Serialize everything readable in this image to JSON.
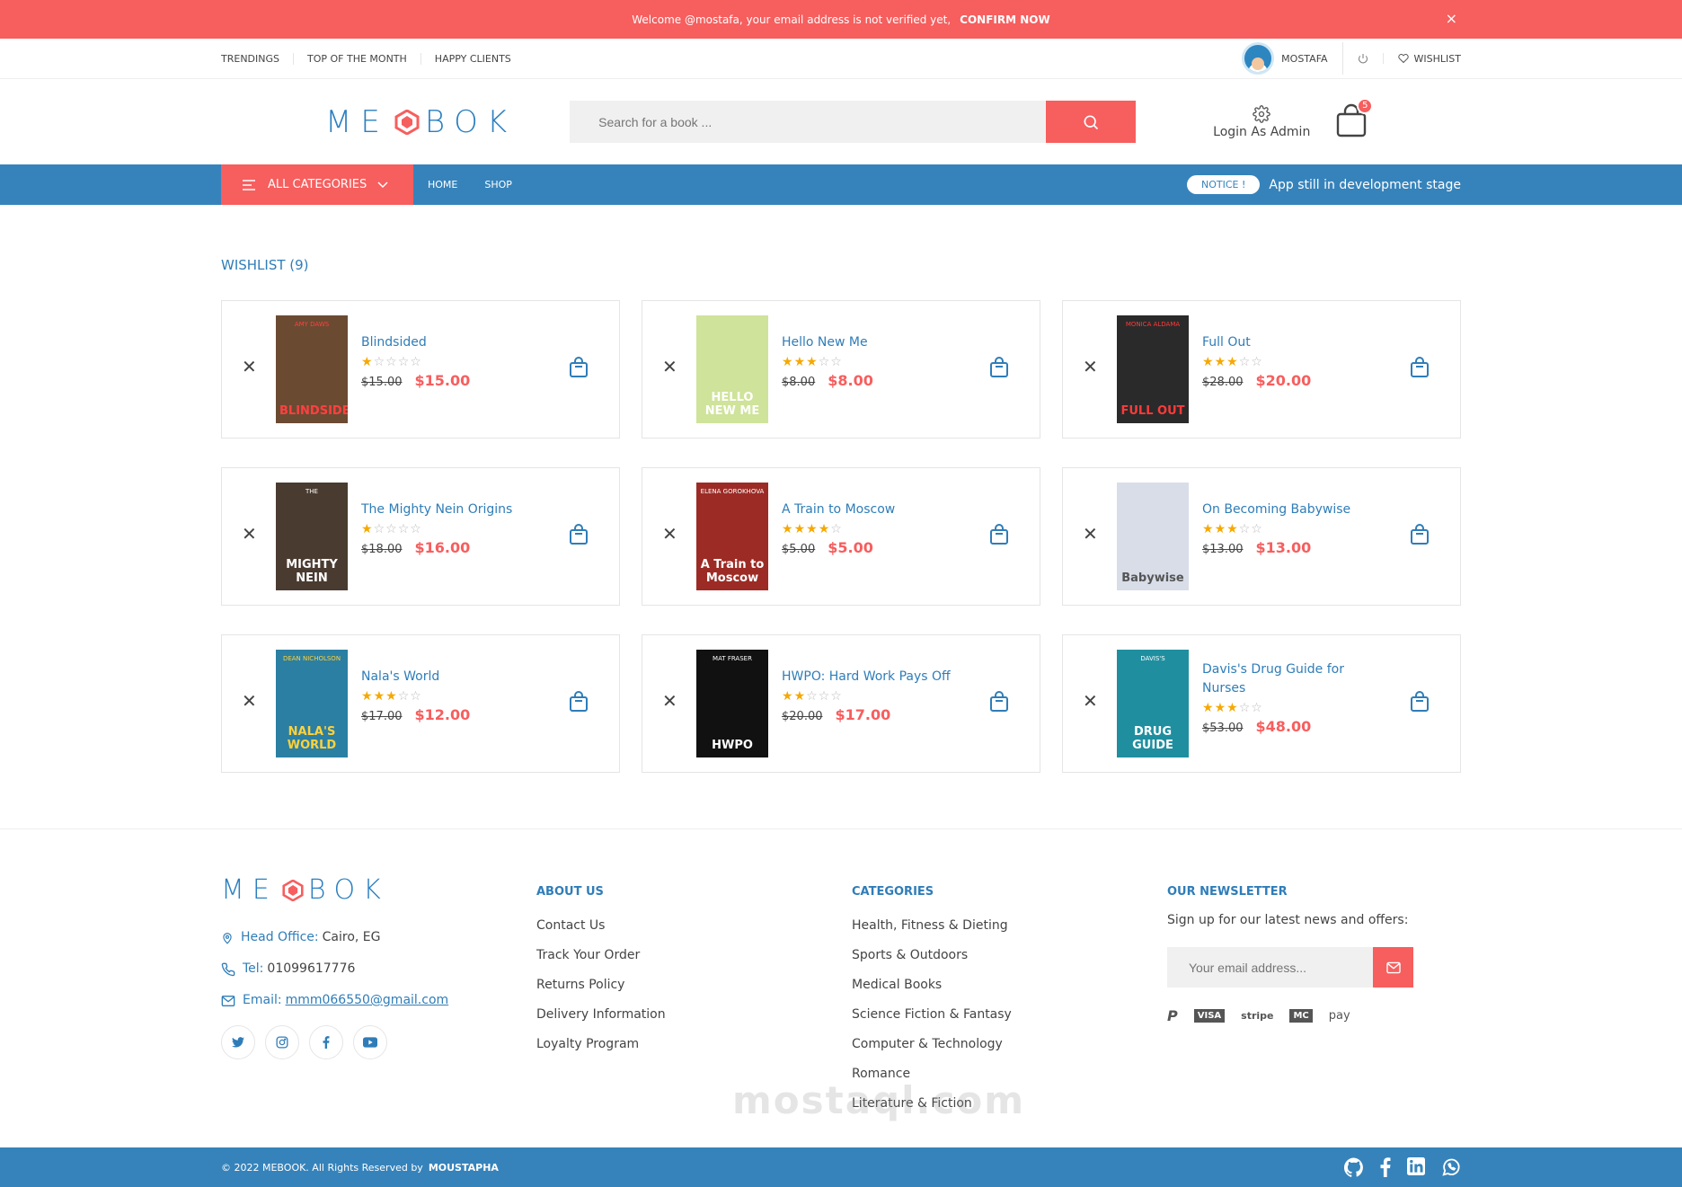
{
  "alert": {
    "message": "Welcome @mostafa, your email address is not verified yet,",
    "action": "CONFIRM NOW",
    "close": "×"
  },
  "topbar": {
    "links": [
      "TRENDINGS",
      "TOP OF THE MONTH",
      "HAPPY CLIENTS"
    ],
    "user": "MOSTAFA",
    "wishlist": "WISHLIST"
  },
  "header": {
    "logo": "MEBOOK",
    "search_placeholder": "Search for a book ...",
    "admin_label": "Login As Admin",
    "cart_count": "5"
  },
  "nav": {
    "all_categories": "ALL CATEGORIES",
    "links": [
      "HOME",
      "SHOP"
    ],
    "notice_tag": "NOTICE !",
    "notice_text": "App still in development stage"
  },
  "wishlist": {
    "title": "WISHLIST (9)",
    "items": [
      {
        "name": "Blindsided",
        "rating": 1,
        "old": "$15.00",
        "price": "$15.00",
        "cover": "BLINDSIDED",
        "cover_top": "AMY DAWS",
        "bg": "#6b4a32",
        "fg": "#ff4040"
      },
      {
        "name": "Hello New Me",
        "rating": 3,
        "old": "$8.00",
        "price": "$8.00",
        "cover": "HELLO NEW ME",
        "cover_top": "",
        "bg": "#cfe39a",
        "fg": "#ffffff"
      },
      {
        "name": "Full Out",
        "rating": 3,
        "old": "$28.00",
        "price": "$20.00",
        "cover": "FULL OUT",
        "cover_top": "MONICA ALDAMA",
        "bg": "#2a2a2a",
        "fg": "#ff3a3a"
      },
      {
        "name": "The Mighty Nein Origins",
        "rating": 1,
        "old": "$18.00",
        "price": "$16.00",
        "cover": "MIGHTY NEIN",
        "cover_top": "THE",
        "bg": "#4a3b30",
        "fg": "#ffffff"
      },
      {
        "name": "A Train to Moscow",
        "rating": 4,
        "old": "$5.00",
        "price": "$5.00",
        "cover": "A Train to Moscow",
        "cover_top": "ELENA GOROKHOVA",
        "bg": "#9c2b25",
        "fg": "#ffffff"
      },
      {
        "name": "On Becoming Babywise",
        "rating": 3,
        "old": "$13.00",
        "price": "$13.00",
        "cover": "Babywise",
        "cover_top": "",
        "bg": "#d8dde8",
        "fg": "#555555"
      },
      {
        "name": "Nala's World",
        "rating": 3,
        "old": "$17.00",
        "price": "$12.00",
        "cover": "NALA'S WORLD",
        "cover_top": "DEAN NICHOLSON",
        "bg": "#2b7fa3",
        "fg": "#ffd23a"
      },
      {
        "name": "HWPO: Hard Work Pays Off",
        "rating": 2,
        "old": "$20.00",
        "price": "$17.00",
        "cover": "HWPO",
        "cover_top": "MAT FRASER",
        "bg": "#111111",
        "fg": "#ffffff"
      },
      {
        "name": "Davis's Drug Guide for Nurses",
        "rating": 3,
        "old": "$53.00",
        "price": "$48.00",
        "cover": "DRUG GUIDE",
        "cover_top": "DAVIS'S",
        "bg": "#1f8fa0",
        "fg": "#ffffff"
      }
    ]
  },
  "footer": {
    "logo": "MEBOOK",
    "office_label": "Head Office:",
    "office": "Cairo, EG",
    "tel_label": "Tel:",
    "tel": "01099617776",
    "email_label": "Email:",
    "email": "mmm066550@gmail.com",
    "about_title": "ABOUT US",
    "about": [
      "Contact Us",
      "Track Your Order",
      "Returns Policy",
      "Delivery Information",
      "Loyalty Program"
    ],
    "categories_title": "CATEGORIES",
    "categories": [
      "Health, Fitness & Dieting",
      "Sports & Outdoors",
      "Medical Books",
      "Science Fiction & Fantasy",
      "Computer & Technology",
      "Romance",
      "Literature & Fiction"
    ],
    "newsletter_title": "OUR NEWSLETTER",
    "newsletter_text": "Sign up for our latest news and offers:",
    "newsletter_placeholder": "Your email address...",
    "payments": [
      "P",
      "VISA",
      "stripe",
      "MC",
      "pay"
    ]
  },
  "bottom": {
    "copyright": "© 2022 MEBOOK. All Rights Reserved by",
    "author": "MOUSTAPHA"
  },
  "watermark": "mostaql.com"
}
